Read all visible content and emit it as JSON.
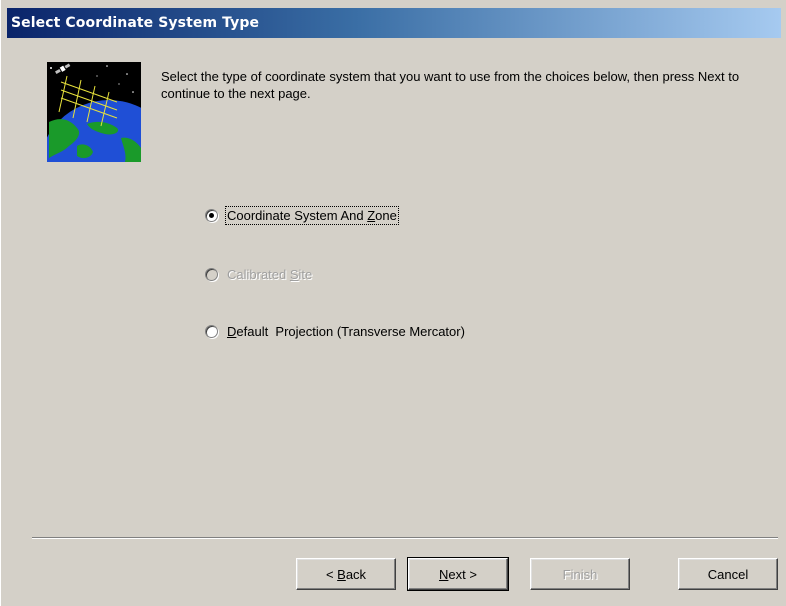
{
  "window": {
    "title": "Select Coordinate System Type"
  },
  "intro": {
    "text": "Select the type of coordinate system that you want to use from the choices below, then press Next to continue to the next page."
  },
  "options": [
    {
      "pre": "Coordinate System And ",
      "key": "Z",
      "post": "one",
      "checked": true,
      "enabled": true
    },
    {
      "pre": "Calibrated ",
      "key": "S",
      "post": "ite",
      "checked": false,
      "enabled": false
    },
    {
      "pre": "",
      "key": "D",
      "post": "efault  Projection (Transverse Mercator)",
      "checked": false,
      "enabled": true
    }
  ],
  "buttons": {
    "back": {
      "pre": "< ",
      "key": "B",
      "post": "ack"
    },
    "next": {
      "pre": "",
      "key": "N",
      "post": "ext >"
    },
    "finish": {
      "label": "Finish"
    },
    "cancel": {
      "label": "Cancel"
    }
  },
  "icons": {
    "wizard": "globe-satellite-icon",
    "radio": "radio-button-icon"
  },
  "colors": {
    "titlebar_start": "#0a246a",
    "titlebar_end": "#a6caf0",
    "dialog_bg": "#d4d0c8",
    "disabled_text": "#a0a0a0"
  }
}
